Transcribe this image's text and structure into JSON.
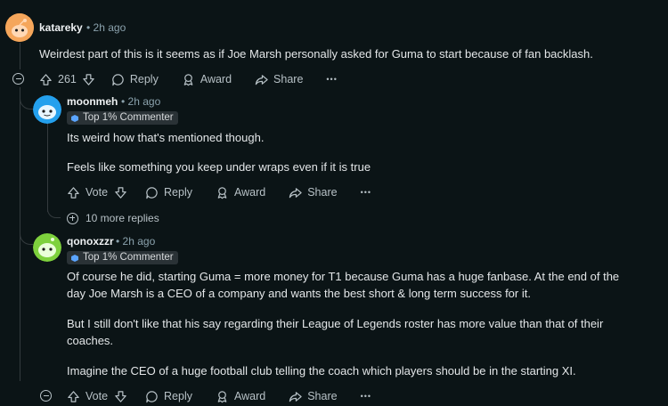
{
  "comments": [
    {
      "username": "katareky",
      "time": "• 2h ago",
      "lines": [
        "Weirdest part of this is it seems as if Joe Marsh personally asked for Guma to start because of fan backlash."
      ],
      "votes": "261",
      "actions": {
        "reply": "Reply",
        "award": "Award",
        "share": "Share",
        "more": "•••"
      }
    },
    {
      "username": "moonmeh",
      "time": "• 2h ago",
      "flair": "Top 1% Commenter",
      "lines": [
        "Its weird how that's mentioned though.",
        "Feels like something you keep under wraps even if it is true"
      ],
      "votes": "Vote",
      "actions": {
        "reply": "Reply",
        "award": "Award",
        "share": "Share",
        "more": "•••"
      },
      "more_replies": "10 more replies"
    },
    {
      "username": "qonoxzzr",
      "time": "• 2h ago",
      "flair": "Top 1% Commenter",
      "lines": [
        "Of course he did, starting Guma = more money for T1 because Guma has a huge fanbase. At the end of the",
        "day Joe Marsh is a CEO of a company and wants the best short & long term success for it.",
        "But I still don't like that his say regarding their League of Legends roster has more value than that of their",
        "coaches.",
        "Imagine the CEO of a huge football club telling the coach which players should be in the starting XI."
      ],
      "votes": "Vote",
      "actions": {
        "reply": "Reply",
        "award": "Award",
        "share": "Share",
        "more": "•••"
      }
    }
  ],
  "icons": [
    "upvote-icon",
    "downvote-icon",
    "reply-icon",
    "award-icon",
    "share-icon",
    "collapse-icon",
    "expand-icon",
    "flair-icon"
  ],
  "colors": {
    "background": "#0b1416",
    "text": "#d7dadc",
    "meta": "#8ba2ad",
    "flair_bg": "#2a3236"
  }
}
